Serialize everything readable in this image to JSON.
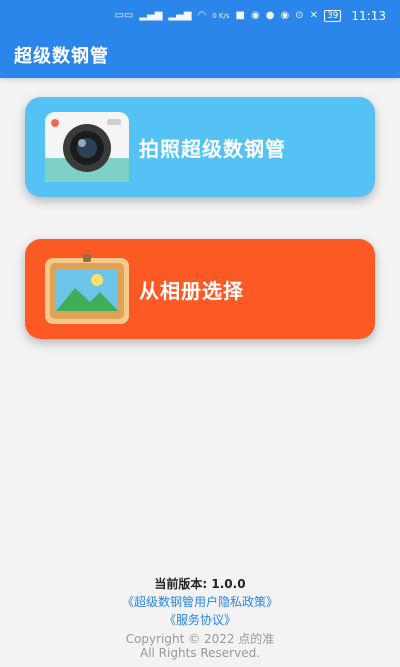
{
  "status_bar": {
    "time": "11:13",
    "battery": "39",
    "network_speed": "0 K/s"
  },
  "app_bar": {
    "title": "超级数钢管"
  },
  "actions": {
    "camera_label": "拍照超级数钢管",
    "album_label": "从相册选择"
  },
  "colors": {
    "primary": "#2a86ea",
    "camera_card": "#54c2f5",
    "album_card": "#fb5a24"
  },
  "footer": {
    "version": "当前版本: 1.0.0",
    "privacy_link": "《超级数钢管用户隐私政策》",
    "service_link": "《服务协议》",
    "copyright": "Copyright © 2022 点的准",
    "rights": "All Rights Reserved."
  }
}
